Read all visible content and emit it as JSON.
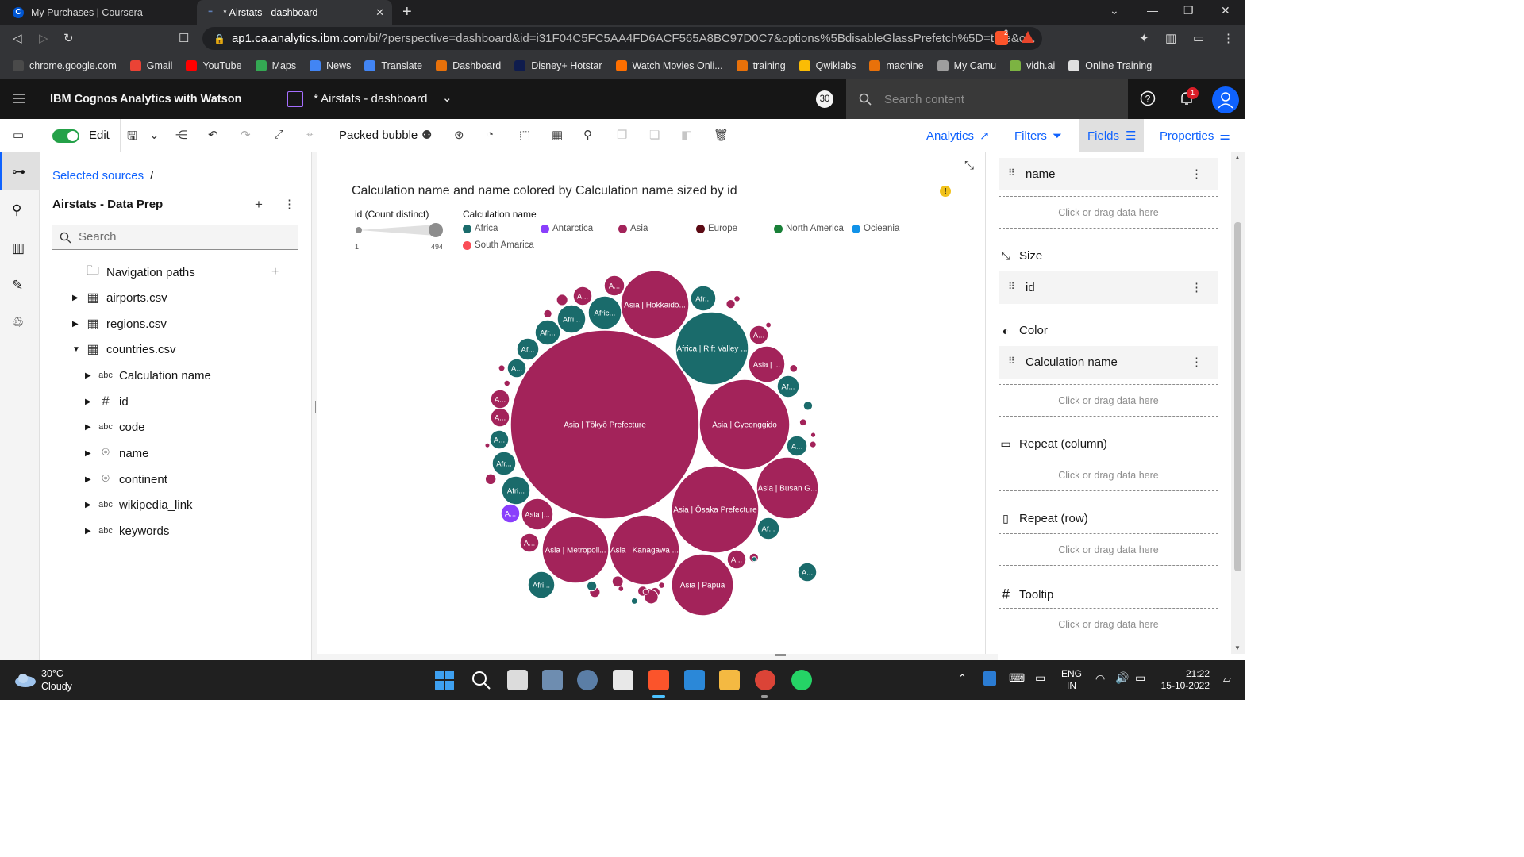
{
  "browser": {
    "tabs": [
      {
        "title": "My Purchases | Coursera",
        "active": false
      },
      {
        "title": "* Airstats - dashboard",
        "active": true
      }
    ],
    "url_host": "ap1.ca.analytics.ibm.com",
    "url_path": "/bi/?perspective=dashboard&id=i31F04C5FC5AA4FD6ACF565A8BC97D0C7&options%5BdisableGlassPrefetch%5D=true&o...",
    "shield_count": "2",
    "bookmarks": [
      {
        "label": "chrome.google.com",
        "color": "#4a4a4a"
      },
      {
        "label": "Gmail",
        "color": "#ea4335"
      },
      {
        "label": "YouTube",
        "color": "#ff0000"
      },
      {
        "label": "Maps",
        "color": "#34a853"
      },
      {
        "label": "News",
        "color": "#4285f4"
      },
      {
        "label": "Translate",
        "color": "#4285f4"
      },
      {
        "label": "Dashboard",
        "color": "#e8710a"
      },
      {
        "label": "Disney+ Hotstar",
        "color": "#0f1c4d"
      },
      {
        "label": "Watch Movies Onli...",
        "color": "#ff6f00"
      },
      {
        "label": "training",
        "color": "#e8710a"
      },
      {
        "label": "Qwiklabs",
        "color": "#fbbc04"
      },
      {
        "label": "machine",
        "color": "#e8710a"
      },
      {
        "label": "My Camu",
        "color": "#9e9e9e"
      },
      {
        "label": "vidh.ai",
        "color": "#7cb342"
      },
      {
        "label": "Online Training",
        "color": "#e0e0e0"
      }
    ]
  },
  "app": {
    "brand": "IBM Cognos Analytics with Watson",
    "dashboard_name": "* Airstats - dashboard",
    "count_badge": "30",
    "search_placeholder": "Search content",
    "notification_count": "1"
  },
  "toolbar": {
    "edit_label": "Edit",
    "viz_type": "Packed bubble",
    "right_tabs": {
      "analytics": "Analytics",
      "filters": "Filters",
      "fields": "Fields",
      "properties": "Properties"
    }
  },
  "sources": {
    "breadcrumb": "Selected sources",
    "breadcrumb_sep": "/",
    "source_name": "Airstats - Data Prep",
    "search_placeholder": "Search",
    "tree": [
      {
        "label": "Navigation paths",
        "icon": "folder-icon",
        "indent": 0
      },
      {
        "label": "airports.csv",
        "icon": "table-icon",
        "indent": 0
      },
      {
        "label": "regions.csv",
        "icon": "table-icon",
        "indent": 0
      },
      {
        "label": "countries.csv",
        "icon": "table-icon",
        "indent": 0
      },
      {
        "label": "Calculation name",
        "icon": "abc-icon",
        "indent": 1
      },
      {
        "label": "id",
        "icon": "hash-icon",
        "indent": 1
      },
      {
        "label": "code",
        "icon": "abc-icon",
        "indent": 1
      },
      {
        "label": "name",
        "icon": "location-icon",
        "indent": 1
      },
      {
        "label": "continent",
        "icon": "location-icon",
        "indent": 1
      },
      {
        "label": "wikipedia_link",
        "icon": "abc-icon",
        "indent": 1
      },
      {
        "label": "keywords",
        "icon": "abc-icon",
        "indent": 1
      }
    ]
  },
  "chart": {
    "title": "Calculation name and name colored by Calculation name sized by id",
    "size_legend_title": "id (Count distinct)",
    "size_min": "1",
    "size_max": "494",
    "color_legend_title": "Calculation name",
    "legend": [
      {
        "label": "Africa",
        "color": "#1a6b6b"
      },
      {
        "label": "Antarctica",
        "color": "#8a3ffc"
      },
      {
        "label": "Asia",
        "color": "#a3235a"
      },
      {
        "label": "Europe",
        "color": "#5c0a14"
      },
      {
        "label": "North America",
        "color": "#198038"
      },
      {
        "label": "Ocieania",
        "color": "#1192e8"
      },
      {
        "label": "South Amarica",
        "color": "#fa4d56"
      }
    ]
  },
  "chart_data": {
    "type": "packed-bubble",
    "title": "Calculation name and name colored by Calculation name sized by id",
    "size_measure": "id (Count distinct)",
    "size_range": [
      1,
      494
    ],
    "color_by": "Calculation name",
    "labeled_bubbles": [
      {
        "label": "Asia | Tōkyō Prefecture",
        "group": "Asia",
        "r": 119
      },
      {
        "label": "Asia | Gyeonggido",
        "group": "Asia",
        "r": 57
      },
      {
        "label": "Asia | Ōsaka Prefecture",
        "group": "Asia",
        "r": 55
      },
      {
        "label": "Africa | Rift Valley ...",
        "group": "Africa",
        "r": 46
      },
      {
        "label": "Asia | Hokkaidō...",
        "group": "Asia",
        "r": 43
      },
      {
        "label": "Asia | Kanagawa ...",
        "group": "Asia",
        "r": 44
      },
      {
        "label": "Asia | Metropoli...",
        "group": "Asia",
        "r": 42
      },
      {
        "label": "Asia | Busan G...",
        "group": "Asia",
        "r": 39
      },
      {
        "label": "Asia | Papua",
        "group": "Asia",
        "r": 39
      },
      {
        "label": "Asia | ...",
        "group": "Asia",
        "r": 23
      },
      {
        "label": "Asia |...",
        "group": "Asia",
        "r": 20
      },
      {
        "label": "Afric...",
        "group": "Africa",
        "r": 21
      },
      {
        "label": "Afri...",
        "group": "Africa",
        "r": 18
      },
      {
        "label": "Afri...",
        "group": "Africa",
        "r": 18
      },
      {
        "label": "Afr...",
        "group": "Africa",
        "r": 16
      },
      {
        "label": "Afr...",
        "group": "Africa",
        "r": 16
      },
      {
        "label": "Afr...",
        "group": "Africa",
        "r": 15
      },
      {
        "label": "Afri...",
        "group": "Africa",
        "r": 17
      },
      {
        "label": "Af...",
        "group": "Africa",
        "r": 14
      },
      {
        "label": "Af...",
        "group": "Africa",
        "r": 14
      },
      {
        "label": "Af...",
        "group": "Africa",
        "r": 14
      },
      {
        "label": "A...",
        "group": "Asia",
        "r": 13
      },
      {
        "label": "A...",
        "group": "Asia",
        "r": 12
      },
      {
        "label": "A...",
        "group": "Africa",
        "r": 12
      },
      {
        "label": "A...",
        "group": "Asia",
        "r": 12
      },
      {
        "label": "A...",
        "group": "Africa",
        "r": 12
      },
      {
        "label": "A...",
        "group": "Asia",
        "r": 12
      },
      {
        "label": "A...",
        "group": "Asia",
        "r": 12
      },
      {
        "label": "A...",
        "group": "Asia",
        "r": 12
      },
      {
        "label": "A...",
        "group": "Africa",
        "r": 13
      },
      {
        "label": "A...",
        "group": "Antarctica",
        "r": 12
      },
      {
        "label": "A...",
        "group": "Asia",
        "r": 12
      },
      {
        "label": "A...",
        "group": "Africa",
        "r": 12
      }
    ]
  },
  "fields": {
    "slots": [
      {
        "label": "name",
        "filled": true
      },
      {
        "label": "Click or drag data here",
        "filled": false
      }
    ],
    "size_head": "Size",
    "size_field": "id",
    "color_head": "Color",
    "color_field": "Calculation name",
    "color_drop": "Click or drag data here",
    "repeat_col_head": "Repeat (column)",
    "repeat_col_drop": "Click or drag data here",
    "repeat_row_head": "Repeat (row)",
    "repeat_row_drop": "Click or drag data here",
    "tooltip_head": "Tooltip",
    "tooltip_drop": "Click or drag data here"
  },
  "taskbar": {
    "temp": "30°C",
    "weather": "Cloudy",
    "lang1": "ENG",
    "lang2": "IN",
    "time": "21:22",
    "date": "15-10-2022"
  }
}
